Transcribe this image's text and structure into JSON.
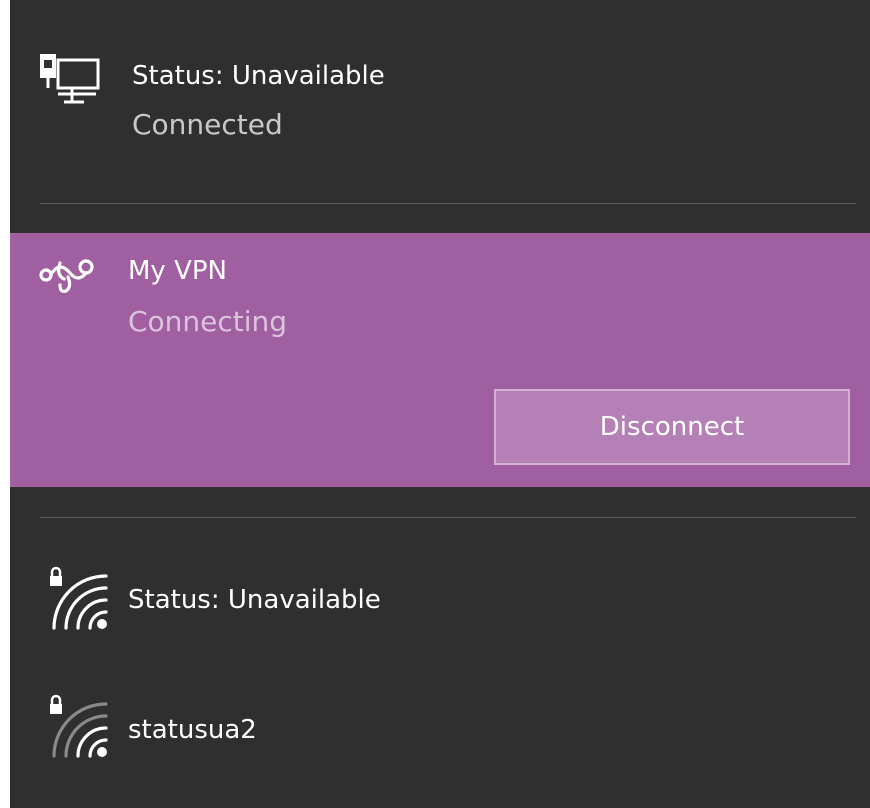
{
  "networks": {
    "ethernet": {
      "icon": "ethernet-icon",
      "name": "Status: Unavailable",
      "status": "Connected"
    },
    "vpn": {
      "icon": "vpn-icon",
      "name": "My VPN",
      "status": "Connecting",
      "disconnect_label": "Disconnect"
    },
    "wifi": [
      {
        "icon": "wifi-secured-icon",
        "name": "Status: Unavailable"
      },
      {
        "icon": "wifi-secured-icon",
        "name": "statusua2"
      }
    ]
  },
  "colors": {
    "panel_background": "#2f2f2f",
    "selected_accent": "#a05fa1",
    "button_fill": "#b480b5",
    "secondary_text": "#c8c8c8"
  }
}
